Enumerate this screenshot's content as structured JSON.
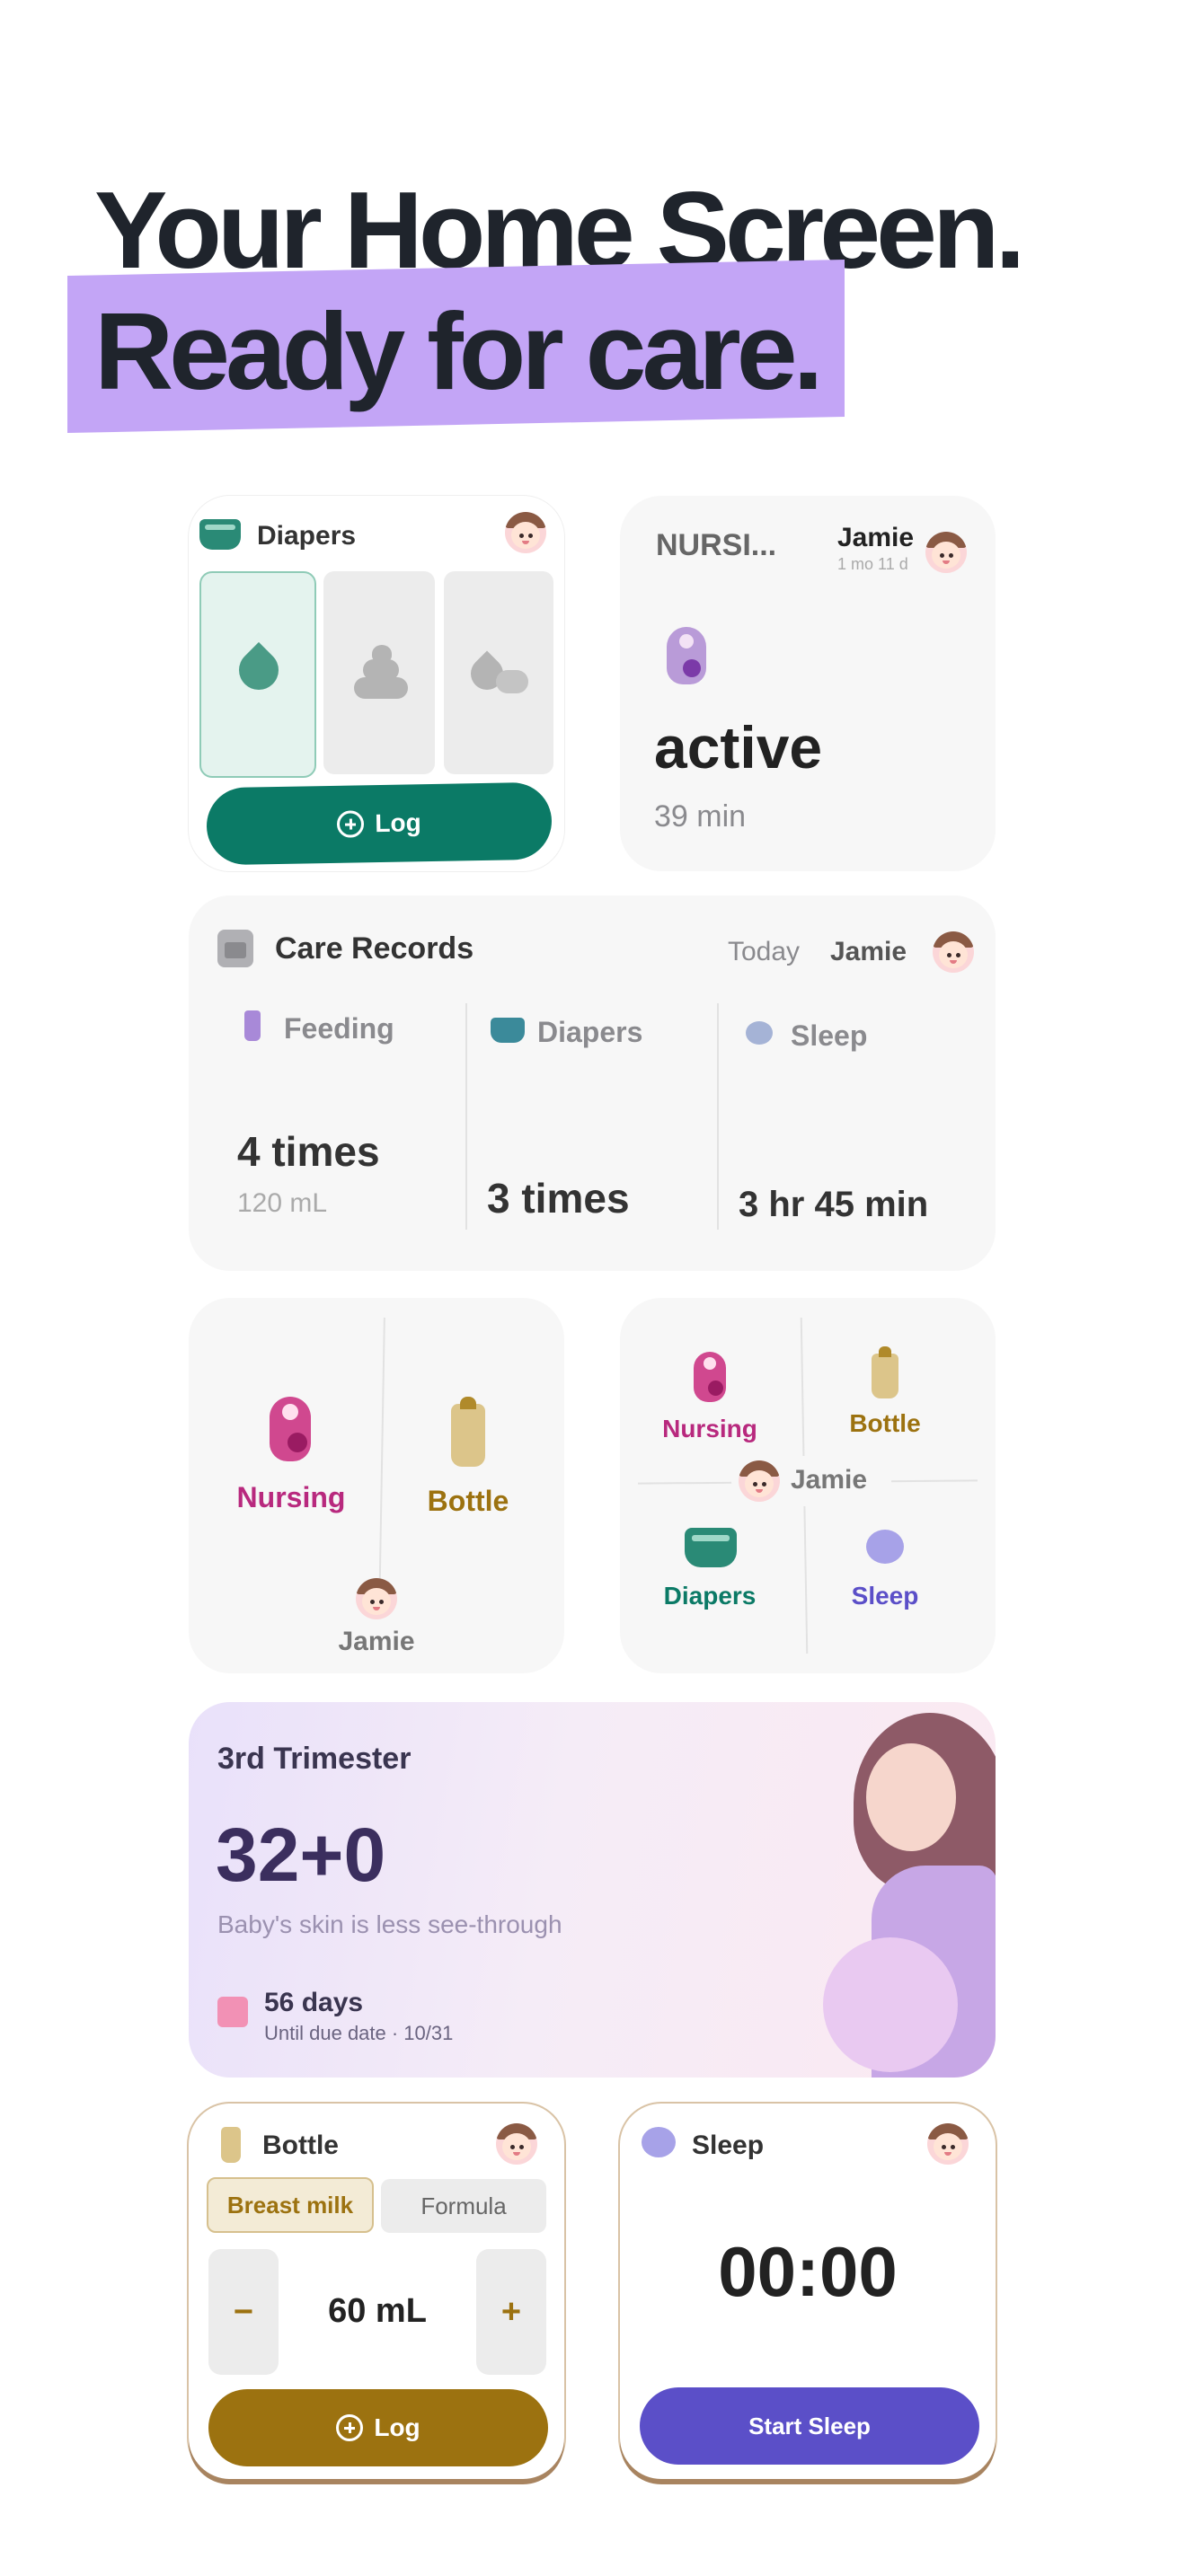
{
  "headline": {
    "line1": "Your Home Screen.",
    "line2": "Ready for care."
  },
  "diapers_widget": {
    "title": "Diapers",
    "log_label": "Log",
    "icons": [
      "pee-drop-icon",
      "poop-icon",
      "mixed-icon"
    ]
  },
  "nursing_widget": {
    "title": "NURSI...",
    "child": "Jamie",
    "age": "1 mo 11 d",
    "status": "active",
    "duration": "39 min"
  },
  "care_records": {
    "title": "Care Records",
    "period": "Today",
    "child": "Jamie",
    "columns": [
      {
        "label": "Feeding",
        "value": "4 times",
        "sub": "120 mL"
      },
      {
        "label": "Diapers",
        "value": "3 times",
        "sub": ""
      },
      {
        "label": "Sleep",
        "value": "3 hr 45 min",
        "sub": ""
      }
    ]
  },
  "quick_two": {
    "nursing": "Nursing",
    "bottle": "Bottle",
    "child": "Jamie"
  },
  "quick_four": {
    "nursing": "Nursing",
    "bottle": "Bottle",
    "diapers": "Diapers",
    "sleep": "Sleep",
    "child": "Jamie"
  },
  "pregnancy": {
    "trimester": "3rd Trimester",
    "week": "32+0",
    "fact": "Baby's skin is less see-through",
    "days": "56 days",
    "due": "Until due date · 10/31"
  },
  "bottle_widget": {
    "title": "Bottle",
    "tab_active": "Breast milk",
    "tab_inactive": "Formula",
    "minus": "−",
    "plus": "+",
    "amount": "60 mL",
    "log_label": "Log"
  },
  "sleep_widget": {
    "title": "Sleep",
    "timer": "00:00",
    "start_label": "Start Sleep"
  },
  "colors": {
    "teal": "#0b7a66",
    "purple": "#c3a5f6",
    "nursing_pink": "#b8297e",
    "bottle_gold": "#9c7210",
    "sleep_indigo": "#5b4fc8"
  }
}
